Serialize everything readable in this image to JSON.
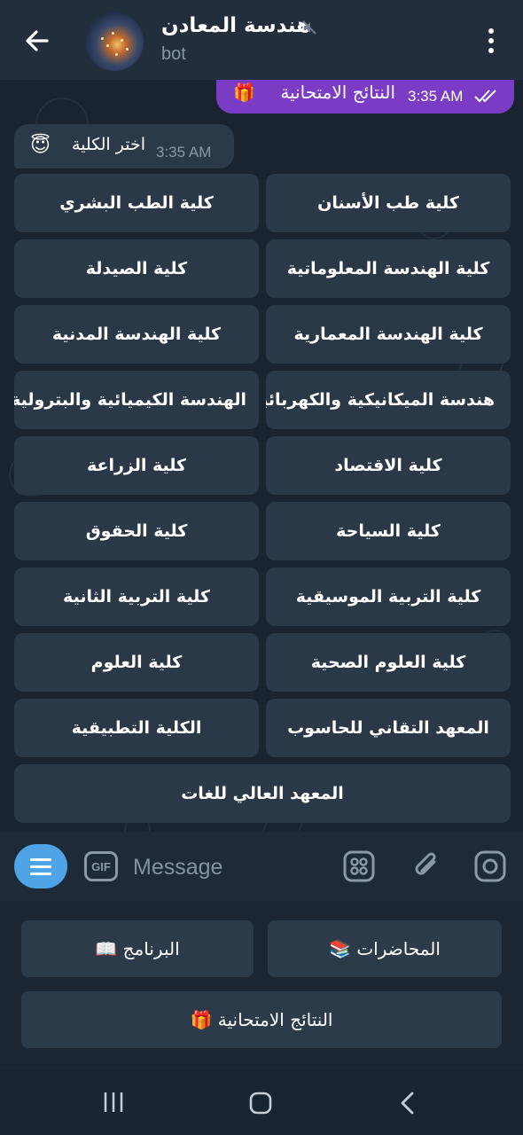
{
  "header": {
    "back_icon": "arrow-left-icon",
    "title": "هندسة المعادن",
    "subtitle": "bot",
    "muted_icon": "muted-speaker-icon",
    "menu_icon": "more-vertical-icon"
  },
  "messages": {
    "outgoing": {
      "text": "النتائج الامتحانية",
      "emoji": "🎁",
      "time": "3:35 AM",
      "status_icon": "double-check-icon"
    },
    "incoming": {
      "text": "اختر الكلية",
      "emoji": "😇",
      "time": "3:35 AM"
    }
  },
  "inline_keyboard": {
    "rows": [
      [
        "كلية طب الأسنان",
        "كلية الطب البشري"
      ],
      [
        "كلية الهندسة المعلوماتية",
        "كلية الصيدلة"
      ],
      [
        "كلية الهندسة المعمارية",
        "كلية الهندسة المدنية"
      ],
      [
        "هندسة الميكانيكية والكهربائية",
        "الهندسة الكيميائية والبترولية"
      ],
      [
        "كلية الاقتصاد",
        "كلية الزراعة"
      ],
      [
        "كلية السياحة",
        "كلية الحقوق"
      ],
      [
        "كلية التربية الموسيقية",
        "كلية التربية الثانية"
      ],
      [
        "كلية العلوم الصحية",
        "كلية العلوم"
      ],
      [
        "المعهد التقاني للحاسوب",
        "الكلية التطبيقية"
      ],
      [
        "المعهد العالي للغات"
      ]
    ]
  },
  "input": {
    "placeholder": "Message",
    "gif_label": "GIF"
  },
  "reply_keyboard": {
    "lectures": "المحاضرات 📚",
    "program": "البرنامج 📖",
    "results": "النتائج الامتحانية 🎁"
  },
  "colors": {
    "header_bg": "#232e3c",
    "outgoing_bubble": "#7a3cc4",
    "accent": "#4ea4e6",
    "button_bg": "#2a3847"
  }
}
